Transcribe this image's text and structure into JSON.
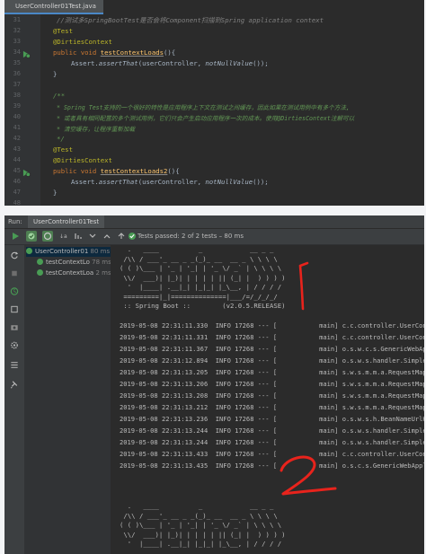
{
  "editor": {
    "tab_label": "UserController01Test.java",
    "line_numbers": [
      "31",
      "32",
      "33",
      "34",
      "35",
      "36",
      "37",
      "38",
      "39",
      "40",
      "41",
      "42",
      "43",
      "44",
      "45",
      "46",
      "47",
      "48",
      "49"
    ],
    "code": {
      "l31": "//测试多SpringBootTest是否会将Component扫描到Spring application context",
      "l32": "@Test",
      "l33": "@DirtiesContext",
      "l34_kw": "public void ",
      "l34_fn": "testContextLoads",
      "l34_end": "(){",
      "l35_a": "Assert.",
      "l35_b": "assertThat",
      "l35_c": "(userController, ",
      "l35_d": "notNullValue",
      "l35_e": "());",
      "l36": "}",
      "l38": "/**",
      "l39": "* Spring Test支持的一个很好的特性是应用程序上下文在测试之间缓存，因此如果在测试用例中有多个方法,",
      "l40": "* 或者具有相同配置的多个测试用例，它们只会产生启动应用程序一次的成本。使用@DirtiesContext注解可以",
      "l41": "* 清空缓存，让程序重新加载",
      "l42": "*/",
      "l43": "@Test",
      "l44": "@DirtiesContext",
      "l45_kw": "public void ",
      "l45_fn": "testContextLoads2",
      "l45_end": "(){",
      "l46_a": "Assert.",
      "l46_b": "assertThat",
      "l46_c": "(userController, ",
      "l46_d": "notNullValue",
      "l46_e": "());",
      "l47": "}"
    }
  },
  "run": {
    "label": "Run:",
    "tab_label": "UserController01Test",
    "status": "Tests passed: 2 of 2 tests – 80 ms",
    "tree": [
      {
        "label": "UserController01 ",
        "time": "80 ms"
      },
      {
        "label": "testContextLo ",
        "time": "78 ms"
      },
      {
        "label": "testContextLoa ",
        "time": "2 ms"
      }
    ]
  },
  "console": {
    "banner1": [
      "  .   ____          _            __ _ _",
      " /\\\\ / ___'_ __ _ _(_)_ __  __ _ \\ \\ \\ \\",
      "( ( )\\___ | '_ | '_| | '_ \\/ _` | \\ \\ \\ \\",
      " \\\\/  ___)| |_)| | | | | || (_| |  ) ) ) )",
      "  '  |____| .__|_| |_|_| |_\\__, | / / / /",
      " =========|_|==============|___/=/_/_/_/",
      " :: Spring Boot ::        (v2.0.5.RELEASE)"
    ],
    "log": [
      "2019-05-08 22:31:11.330  INFO 17268 --- [           main] c.c.controller.UserContr",
      "2019-05-08 22:31:11.331  INFO 17268 --- [           main] c.c.controller.UserContr",
      "2019-05-08 22:31:11.367  INFO 17268 --- [           main] o.s.w.c.s.GenericWebAppl",
      "2019-05-08 22:31:12.894  INFO 17268 --- [           main] o.s.w.s.handler.SimpleUr",
      "2019-05-08 22:31:13.205  INFO 17268 --- [           main] s.w.s.m.m.a.RequestMappi",
      "2019-05-08 22:31:13.206  INFO 17268 --- [           main] s.w.s.m.m.a.RequestMappi",
      "2019-05-08 22:31:13.208  INFO 17268 --- [           main] s.w.s.m.m.a.RequestMappi",
      "2019-05-08 22:31:13.212  INFO 17268 --- [           main] s.w.s.m.m.a.RequestMappi",
      "2019-05-08 22:31:13.236  INFO 17268 --- [           main] o.s.w.s.h.BeanNameUrlHan",
      "2019-05-08 22:31:13.244  INFO 17268 --- [           main] o.s.w.s.handler.SimpleUr",
      "2019-05-08 22:31:13.244  INFO 17268 --- [           main] o.s.w.s.handler.SimpleUr",
      "2019-05-08 22:31:13.433  INFO 17268 --- [           main] c.c.controller.UserContr",
      "2019-05-08 22:31:13.435  INFO 17268 --- [           main] o.s.c.s.GenericWebAppli"
    ],
    "banner2": [
      "  .   ____          _            __ _ _",
      " /\\\\ / ___'_ __ _ _(_)_ __  __ _ \\ \\ \\ \\",
      "( ( )\\___ | '_ | '_| | '_ \\/ _` | \\ \\ \\ \\",
      " \\\\/  ___)| |_)| | | | | || (_| |  ) ) ) )",
      "  '  |____| .__|_| |_|_| |_\\__, | / / / /"
    ],
    "marker_color": "#e8231c"
  }
}
